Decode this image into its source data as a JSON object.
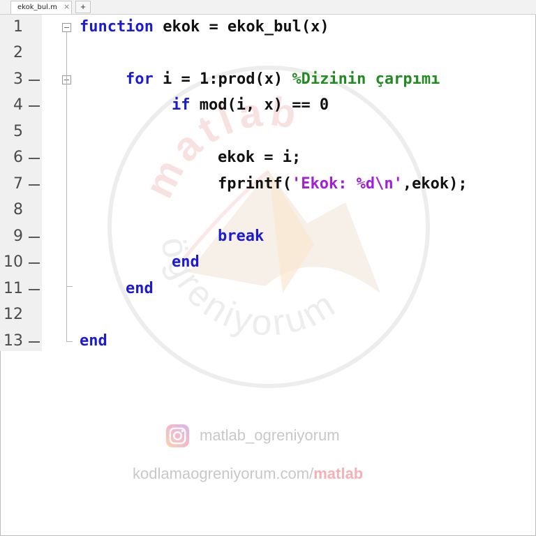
{
  "tabs": [
    {
      "label": "ekok_bul.m",
      "close": "×"
    }
  ],
  "add_tab": "+",
  "lines": [
    {
      "n": "1"
    },
    {
      "n": "2"
    },
    {
      "n": "3"
    },
    {
      "n": "4"
    },
    {
      "n": "5"
    },
    {
      "n": "6"
    },
    {
      "n": "7"
    },
    {
      "n": "8"
    },
    {
      "n": "9"
    },
    {
      "n": "10"
    },
    {
      "n": "11"
    },
    {
      "n": "12"
    },
    {
      "n": "13"
    }
  ],
  "code": {
    "l1_kw": "function",
    "l1_rest": " ekok = ekok_bul(x)",
    "l3_kw": "for",
    "l3_rest": " i = 1:prod(x) ",
    "l3_comment": "%Dizinin çarpımı",
    "l4_kw": "if",
    "l4_rest": " mod(i, x) == 0",
    "l6": "ekok = i;",
    "l7_a": "fprintf(",
    "l7_str": "'Ekok: %d\\n'",
    "l7_b": ",ekok);",
    "l9_kw": "break",
    "l10_kw": "end",
    "l11_kw": "end",
    "l13_kw": "end"
  },
  "watermark": {
    "top_text": "matlab",
    "bottom_text": "ögreniyorum"
  },
  "footer": {
    "instagram": "matlab_ogreniyorum",
    "site_prefix": "kodlamaogreniyorum.com/",
    "site_accent": "matlab"
  },
  "icons": {
    "instagram": "instagram-icon",
    "fold": "fold-collapse-icon",
    "close": "close-icon",
    "add": "plus-icon"
  },
  "colors": {
    "keyword": "#1b1bd6",
    "string": "#a01fd8",
    "comment": "#228b22",
    "footer_accent": "#f3b2b5"
  }
}
